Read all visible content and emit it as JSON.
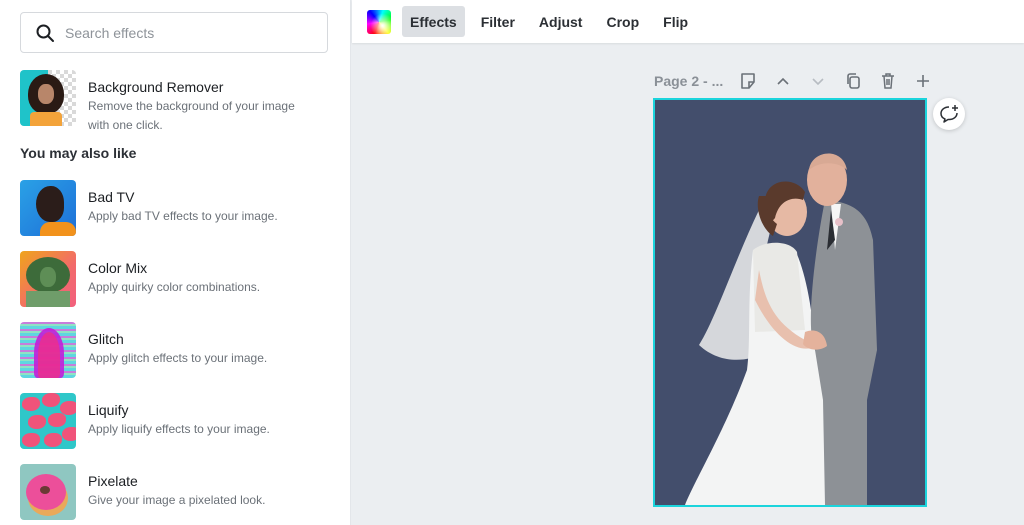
{
  "search": {
    "placeholder": "Search effects",
    "icon": "search-icon"
  },
  "featured": {
    "title": "Background Remover",
    "description": "Remove the background of your image with one click.",
    "thumbnail": "woman-portrait-bg-removed"
  },
  "section_title": "You may also like",
  "effects": [
    {
      "title": "Bad TV",
      "description": "Apply bad TV effects to your image.",
      "thumbnail": "man-profile-blue"
    },
    {
      "title": "Color Mix",
      "description": "Apply quirky color combinations.",
      "thumbnail": "woman-green-duotone"
    },
    {
      "title": "Glitch",
      "description": "Apply glitch effects to your image.",
      "thumbnail": "glitch-portrait"
    },
    {
      "title": "Liquify",
      "description": "Apply liquify effects to your image.",
      "thumbnail": "pink-flowers-teal"
    },
    {
      "title": "Pixelate",
      "description": "Give your image a pixelated look.",
      "thumbnail": "pink-donut"
    }
  ],
  "toolbar": {
    "color_icon": "color-palette-icon",
    "tabs": [
      {
        "label": "Effects",
        "active": true
      },
      {
        "label": "Filter",
        "active": false
      },
      {
        "label": "Adjust",
        "active": false
      },
      {
        "label": "Crop",
        "active": false
      },
      {
        "label": "Flip",
        "active": false
      }
    ]
  },
  "page": {
    "label": "Page 2 - ...",
    "actions": [
      "add-note-icon",
      "move-up-icon",
      "move-down-icon",
      "duplicate-icon",
      "delete-icon",
      "add-page-icon"
    ]
  },
  "canvas": {
    "background_color": "#434e6c",
    "selection_color": "#1bd4dc",
    "image": "wedding-couple-kissing"
  },
  "comment_button": {
    "icon": "add-comment-icon"
  }
}
